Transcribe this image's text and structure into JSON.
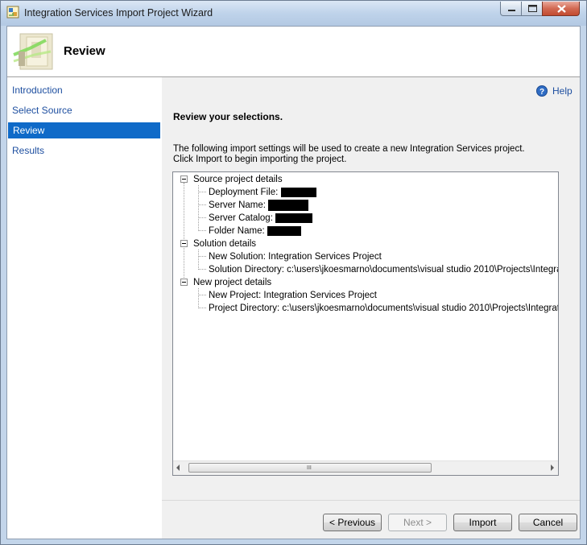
{
  "window": {
    "title": "Integration Services Import Project Wizard"
  },
  "header": {
    "title": "Review"
  },
  "nav": {
    "items": [
      {
        "label": "Introduction",
        "selected": false
      },
      {
        "label": "Select Source",
        "selected": false
      },
      {
        "label": "Review",
        "selected": true
      },
      {
        "label": "Results",
        "selected": false
      }
    ]
  },
  "main": {
    "help_label": "Help",
    "section_title": "Review your selections.",
    "description_line1": "The following import settings will be used to create a new Integration Services project.",
    "description_line2": "Click Import to begin importing the project."
  },
  "tree": {
    "source_details": {
      "label": "Source project details",
      "deployment_file": "Deployment File:",
      "server_name": "Server Name:",
      "server_catalog": "Server Catalog:",
      "folder_name": "Folder Name:"
    },
    "solution_details": {
      "label": "Solution details",
      "new_solution": "New Solution: Integration Services Project",
      "solution_directory": "Solution Directory: c:\\users\\jkoesmarno\\documents\\visual studio 2010\\Projects\\Integration"
    },
    "project_details": {
      "label": "New project details",
      "new_project": "New Project: Integration Services Project",
      "project_directory": "Project Directory: c:\\users\\jkoesmarno\\documents\\visual studio 2010\\Projects\\Integration S"
    },
    "scroll_grip": "III"
  },
  "buttons": {
    "previous": "< Previous",
    "next": "Next >",
    "import": "Import",
    "cancel": "Cancel"
  },
  "colors": {
    "nav_selected": "#0f6ac8",
    "link": "#1e4fa0"
  }
}
